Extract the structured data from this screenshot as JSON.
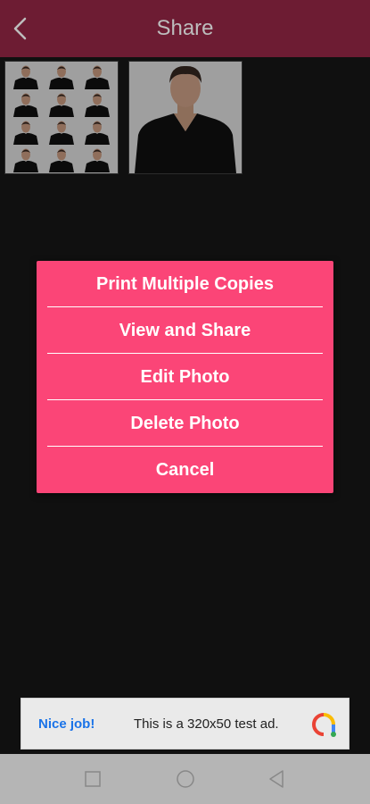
{
  "appbar": {
    "title": "Share"
  },
  "menu": {
    "items": [
      {
        "label": "Print Multiple Copies"
      },
      {
        "label": "View and Share"
      },
      {
        "label": "Edit Photo"
      },
      {
        "label": "Delete Photo"
      },
      {
        "label": "Cancel"
      }
    ]
  },
  "ad": {
    "lead": "Nice job!",
    "text": "This is a 320x50 test ad.",
    "logo_icon": "admob-logo-icon"
  },
  "colors": {
    "appbar": "#6d1c33",
    "dialog": "#fb4577",
    "background": "#191919",
    "ad_link": "#1a73e8"
  },
  "navbar": {
    "icons": [
      "recents-square-icon",
      "home-circle-icon",
      "back-triangle-icon"
    ]
  }
}
